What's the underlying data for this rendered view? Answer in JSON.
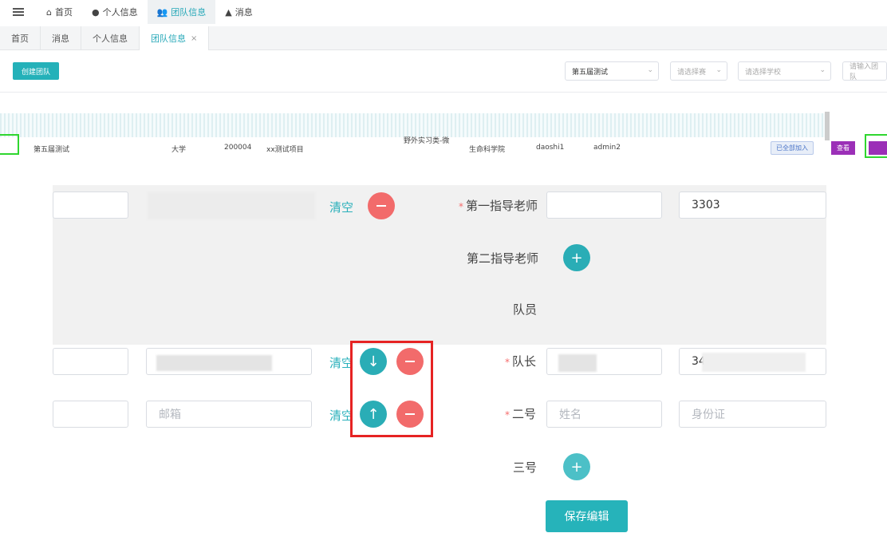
{
  "topnav": {
    "items": [
      {
        "label": "首页",
        "icon": "home-icon"
      },
      {
        "label": "个人信息",
        "icon": "user-icon"
      },
      {
        "label": "团队信息",
        "icon": "team-icon"
      },
      {
        "label": "消息",
        "icon": "bell-icon"
      }
    ],
    "active_color": "#26a8b8"
  },
  "tabs": [
    {
      "label": "首页"
    },
    {
      "label": "消息"
    },
    {
      "label": "个人信息"
    },
    {
      "label": "团队信息",
      "close": "×"
    }
  ],
  "toolbar": {
    "create_label": "创建团队",
    "session_select": "第五届测试",
    "track_placeholder": "请选择赛",
    "school_placeholder": "请选择学校",
    "search_placeholder": "请输入团队"
  },
  "table_row": {
    "session": "第五届测试",
    "school_fragment": "大学",
    "team_no": "200004",
    "project": "xx测试项目",
    "category": "野外实习类-微",
    "college": "生命科学院",
    "teacher": "daoshi1",
    "member": "admin2",
    "status": "已全部加入",
    "view_label": "查看"
  },
  "form": {
    "first_teacher_label": "第一指导老师",
    "first_teacher_id_fragment": "3303",
    "second_teacher_label": "第二指导老师",
    "members_label": "队员",
    "captain_label": "队长",
    "captain_id_fragment": "34",
    "second_label": "二号",
    "third_label": "三号",
    "clear_label": "清空",
    "email_placeholder": "邮箱",
    "name_placeholder": "姓名",
    "id_placeholder": "身份证",
    "save_label": "保存编辑"
  },
  "colors": {
    "primary": "#26b3ba",
    "danger": "#f26b6b",
    "highlight_box": "#e62323"
  }
}
